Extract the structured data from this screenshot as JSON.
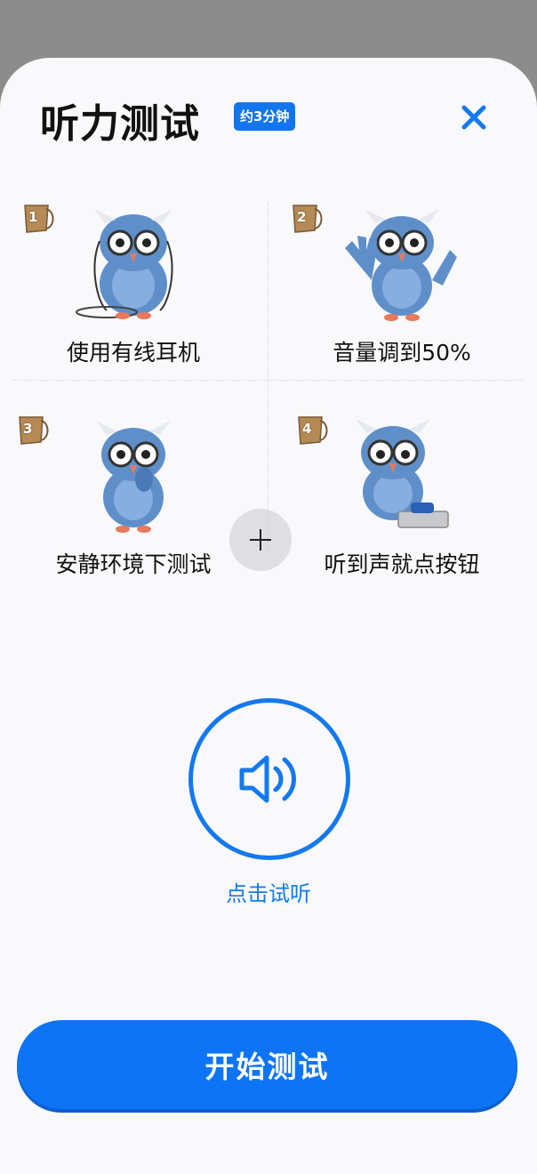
{
  "header": {
    "title": "听力测试",
    "duration_badge": "约3分钟",
    "close_icon": "close-icon"
  },
  "tips": [
    {
      "number": "1",
      "label": "使用有线耳机",
      "icon": "owl-headphones-icon"
    },
    {
      "number": "2",
      "label": "音量调到50%",
      "icon": "owl-waving-icon"
    },
    {
      "number": "3",
      "label": "安静环境下测试",
      "icon": "owl-quiet-icon"
    },
    {
      "number": "4",
      "label": "听到声就点按钮",
      "icon": "owl-button-icon"
    }
  ],
  "listen": {
    "icon": "speaker-icon",
    "label": "点击试听"
  },
  "footer": {
    "start_label": "开始测试"
  },
  "colors": {
    "accent": "#1479ef",
    "owl_blue": "#5f8fc9",
    "text": "#111111",
    "overlay": "#8c8c8c"
  }
}
